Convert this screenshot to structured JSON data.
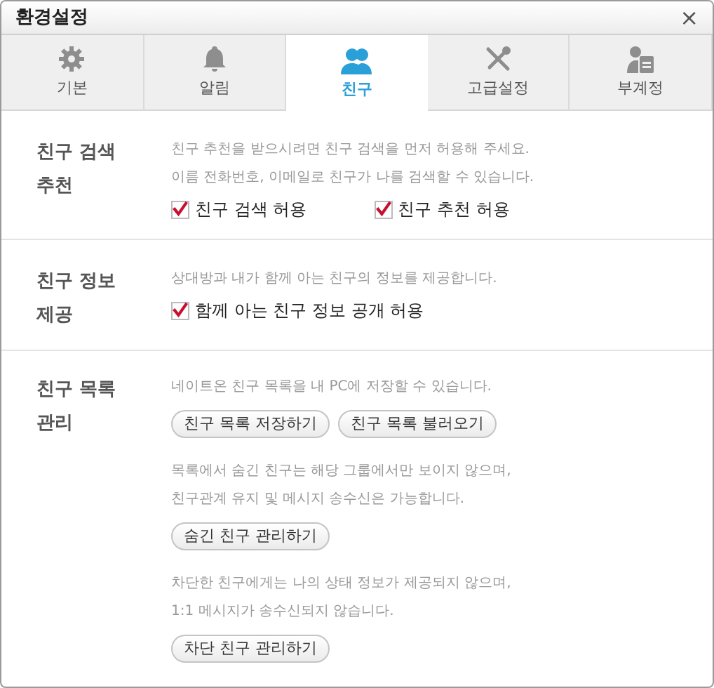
{
  "window": {
    "title": "환경설정",
    "close": "×"
  },
  "tabs": [
    {
      "label": "기본",
      "selected": false
    },
    {
      "label": "알림",
      "selected": false
    },
    {
      "label": "친구",
      "selected": true
    },
    {
      "label": "고급설정",
      "selected": false
    },
    {
      "label": "부계정",
      "selected": false
    }
  ],
  "sections": [
    {
      "title": "친구 검색\n추천",
      "items": [
        {
          "kind": "text",
          "text": "친구 추천을 받으시려면 친구 검색을 먼저 허용해 주세요.\n이름 전화번호, 이메일로 친구가 나를 검색할 수 있습니다."
        },
        {
          "kind": "checkboxes",
          "options": [
            {
              "label": "친구 검색 허용",
              "checked": true
            },
            {
              "label": "친구 추천 허용",
              "checked": true
            }
          ]
        }
      ]
    },
    {
      "title": "친구 정보\n제공",
      "items": [
        {
          "kind": "text",
          "text": "상대방과 내가 함께 아는 친구의 정보를 제공합니다."
        },
        {
          "kind": "checkboxes",
          "options": [
            {
              "label": "함께 아는 친구 정보 공개 허용",
              "checked": true
            }
          ]
        }
      ]
    },
    {
      "title": "친구 목록\n관리",
      "items": [
        {
          "kind": "text",
          "text": "네이트온 친구 목록을 내 PC에 저장할 수 있습니다."
        },
        {
          "kind": "buttons",
          "buttons": [
            "친구 목록 저장하기",
            "친구 목록 불러오기"
          ]
        },
        {
          "kind": "text",
          "text": "목록에서 숨긴 친구는 해당 그룹에서만 보이지 않으며,\n친구관계 유지 및 메시지 송수신은 가능합니다."
        },
        {
          "kind": "buttons",
          "buttons": [
            "숨긴 친구 관리하기"
          ]
        },
        {
          "kind": "text",
          "text": "차단한 친구에게는 나의 상태 정보가 제공되지 않으며,\n1:1 메시지가 송수신되지 않습니다."
        },
        {
          "kind": "buttons",
          "buttons": [
            "차단 친구 관리하기"
          ]
        }
      ]
    }
  ]
}
